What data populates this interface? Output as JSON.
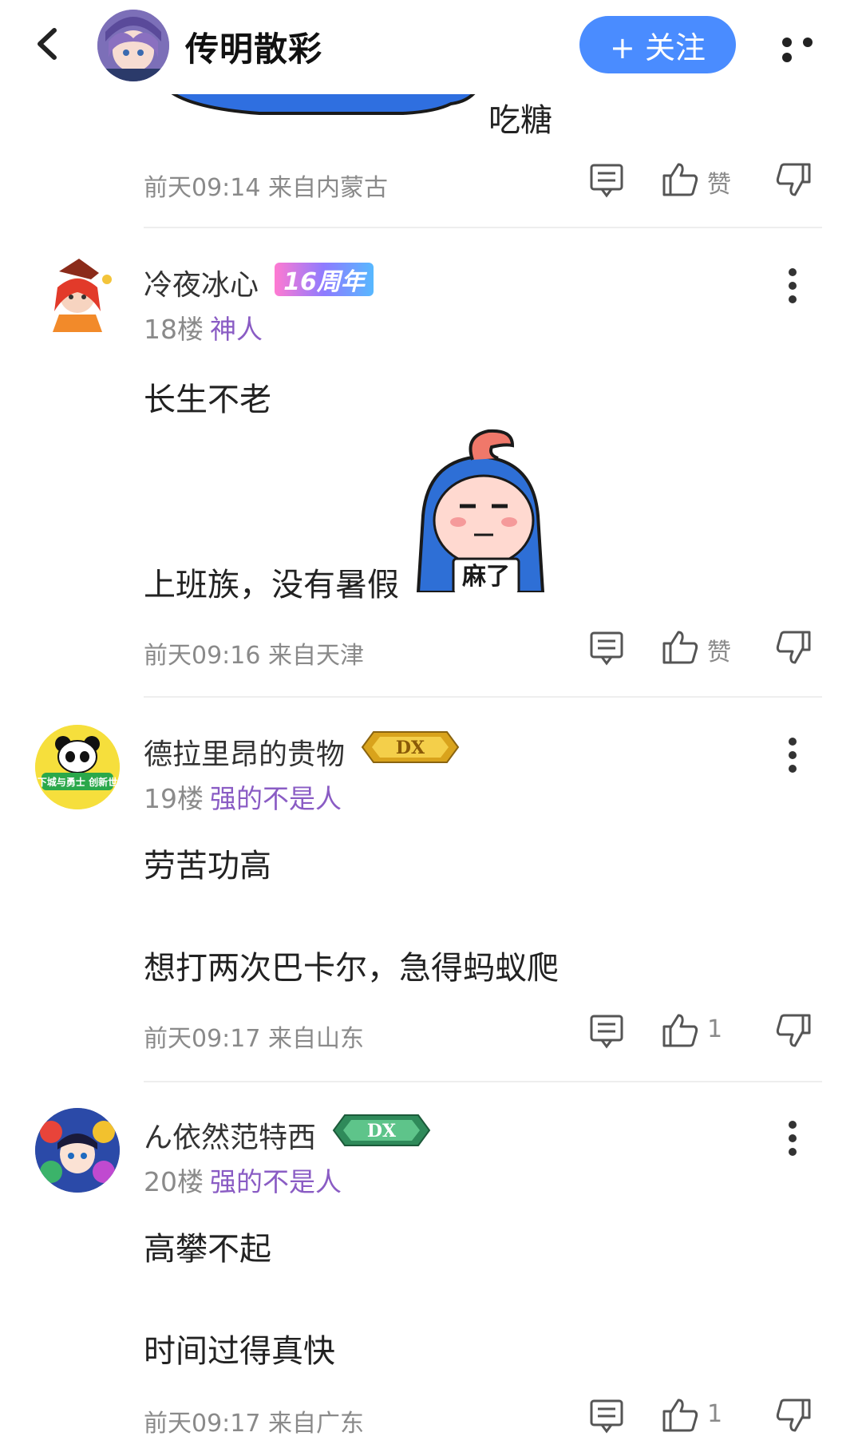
{
  "header": {
    "title": "传明散彩",
    "follow_label": "+ 关注"
  },
  "partial_post": {
    "text": "吃糖",
    "meta": "前天09:14 来自内蒙古",
    "like_label": "赞"
  },
  "posts": [
    {
      "name": "冷夜冰心",
      "badge": "16周年",
      "floor": "18楼",
      "tag": "神人",
      "lines": [
        "长生不老",
        "上班族，没有暑假"
      ],
      "sticker_text": "麻了",
      "meta": "前天09:16 来自天津",
      "like_label": "赞"
    },
    {
      "name": "德拉里昂的贵物",
      "badge": "DX",
      "floor": "19楼",
      "tag": "强的不是人",
      "avatar_text": "地下城与勇士 创新世纪",
      "lines": [
        "劳苦功高",
        "想打两次巴卡尔，急得蚂蚁爬"
      ],
      "meta": "前天09:17 来自山东",
      "like_label": "1"
    },
    {
      "name": "ん依然范特西",
      "badge": "DX",
      "floor": "20楼",
      "tag": "强的不是人",
      "lines": [
        "高攀不起",
        "时间过得真快"
      ],
      "meta": "前天09:17 来自广东",
      "like_label": "1"
    }
  ],
  "colors": {
    "accent": "#4a8cff",
    "tag": "#8a5cc4",
    "meta": "#8a8a8a"
  },
  "icons": [
    "back-arrow-icon",
    "more-icon",
    "comment-icon",
    "thumbs-up-icon",
    "thumbs-down-icon"
  ]
}
